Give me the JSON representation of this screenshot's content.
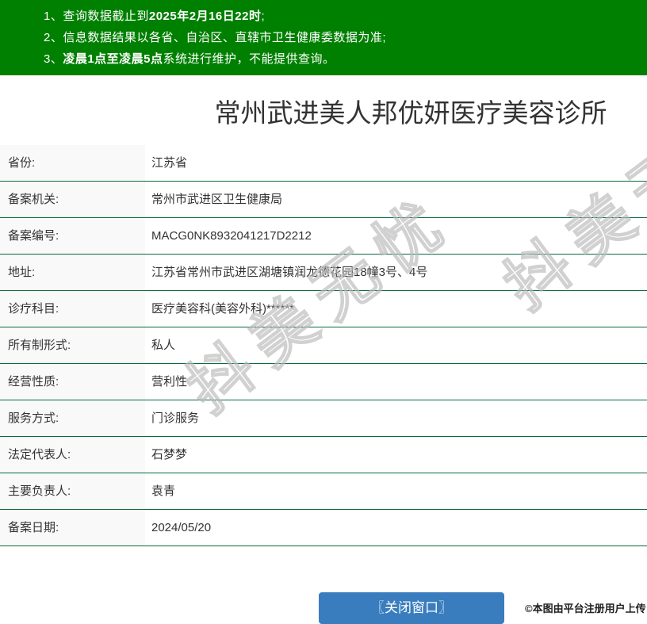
{
  "notices": [
    {
      "num": "1、",
      "segments": {
        "s0": "查询数据截止到",
        "s1": "2025年2月16日22时",
        "s2": ";"
      }
    },
    {
      "num": "2、",
      "segments": {
        "s0": "信息数据结果以各省、自治区、直辖市卫生健康委数据为准;"
      }
    },
    {
      "num": "3、",
      "segments": {
        "s0": "凌晨1点至凌晨5点",
        "s1": "系统进行维护，不能提供查询。"
      }
    }
  ],
  "title": "常州武进美人邦优妍医疗美容诊所",
  "table": {
    "rows": [
      {
        "label": "省份:",
        "value": "江苏省"
      },
      {
        "label": "备案机关:",
        "value": "常州市武进区卫生健康局"
      },
      {
        "label": "备案编号:",
        "value": "MACG0NK8932041217D2212"
      },
      {
        "label": "地址:",
        "value": "江苏省常州市武进区湖塘镇润龙德花园18幢3号、4号"
      },
      {
        "label": "诊疗科目:",
        "value": "医疗美容科(美容外科)******"
      },
      {
        "label": "所有制形式:",
        "value": "私人"
      },
      {
        "label": "经营性质:",
        "value": "营利性"
      },
      {
        "label": "服务方式:",
        "value": "门诊服务"
      },
      {
        "label": "法定代表人:",
        "value": "石梦梦"
      },
      {
        "label": "主要负责人:",
        "value": "袁青"
      },
      {
        "label": "备案日期:",
        "value": "2024/05/20"
      }
    ]
  },
  "watermark": {
    "text": "抖美无忧"
  },
  "footer": {
    "close_button": "〖关闭窗口〗",
    "credit": "©本图由平台注册用户上传"
  },
  "colors": {
    "header_bg": "#008000",
    "row_border": "#0a6c3c",
    "label_bg": "#f9f9f9",
    "button_bg": "#3a7dbe"
  }
}
